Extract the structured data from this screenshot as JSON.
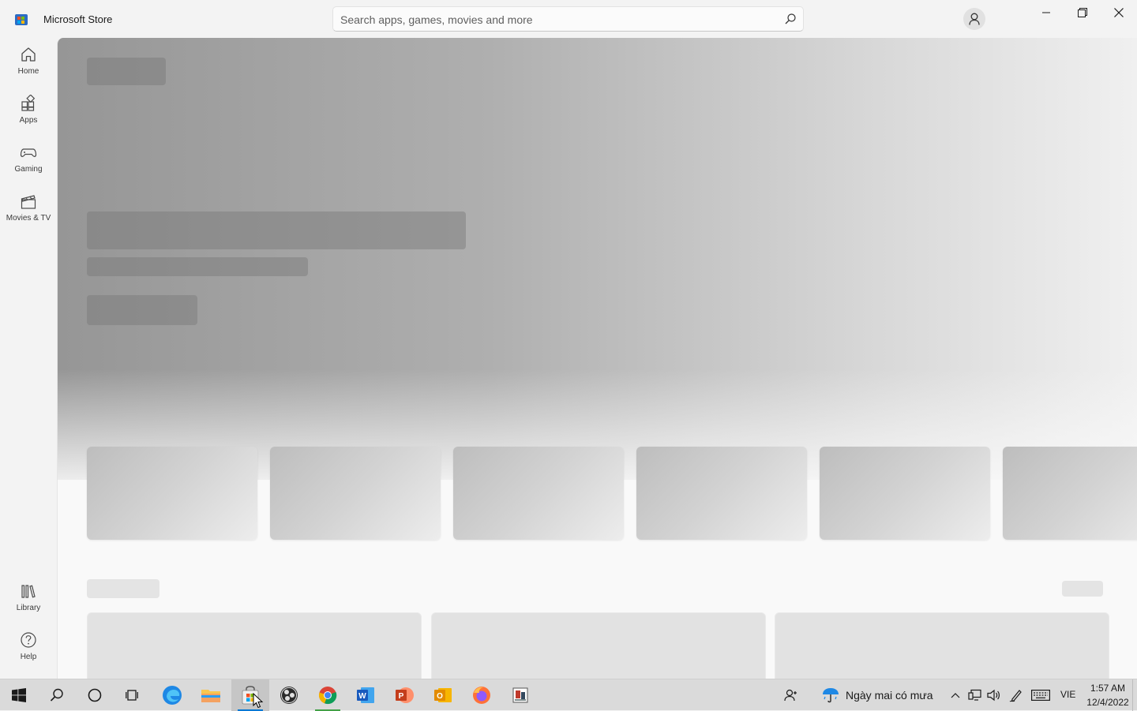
{
  "window": {
    "title": "Microsoft Store",
    "search_placeholder": "Search apps, games, movies and more"
  },
  "nav": {
    "top_items": [
      {
        "label": "Home",
        "icon": "home-icon"
      },
      {
        "label": "Apps",
        "icon": "apps-icon"
      },
      {
        "label": "Gaming",
        "icon": "gaming-icon"
      },
      {
        "label": "Movies & TV",
        "icon": "movies-icon"
      }
    ],
    "bottom_items": [
      {
        "label": "Library",
        "icon": "library-icon"
      },
      {
        "label": "Help",
        "icon": "help-icon"
      }
    ]
  },
  "taskbar": {
    "weather_text": "Ngày mai có mưa",
    "language": "VIE",
    "time": "1:57 AM",
    "date": "12/4/2022"
  },
  "colors": {
    "accent": "#0078d4",
    "skeleton": "#808080"
  }
}
